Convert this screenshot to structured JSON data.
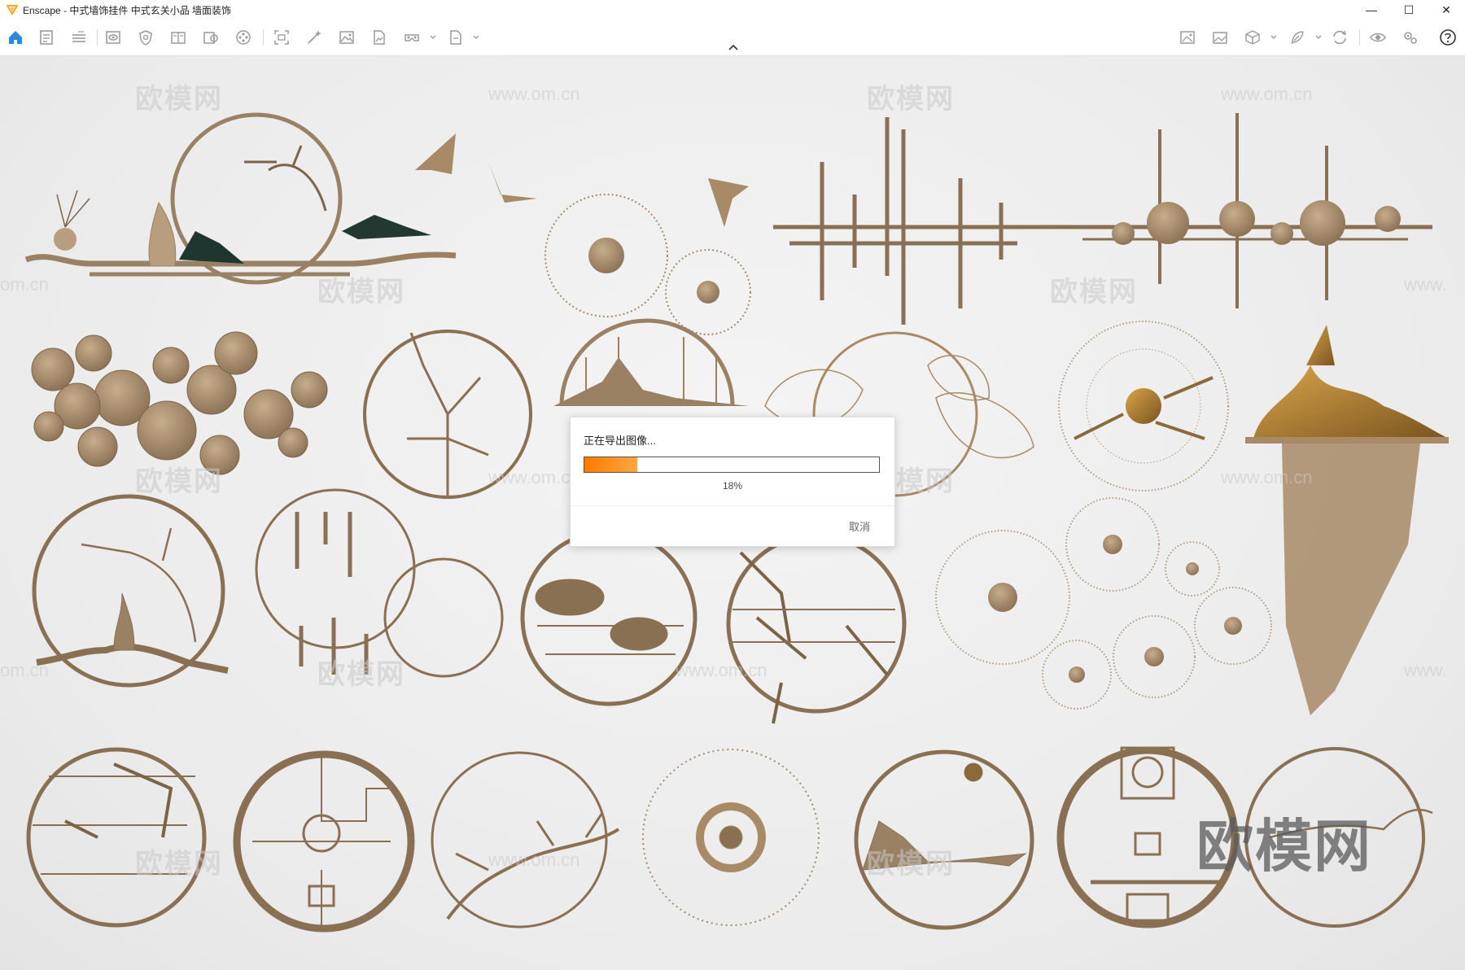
{
  "window": {
    "title": "Enscape - 中式墙饰挂件 中式玄关小品 墙面装饰",
    "controls": {
      "minimize": "—",
      "maximize": "☐",
      "close": "✕"
    }
  },
  "toolbar": {
    "left_icons": [
      "home-icon",
      "document-icon",
      "bim-list-icon",
      "view-eye-icon",
      "shield-icon",
      "book-icon",
      "book-gear-icon",
      "film-reel-icon",
      "capture-icon",
      "magic-wand-icon",
      "image-icon",
      "file-image-icon",
      "vr-headset-icon",
      "export-file-icon"
    ],
    "right_icons": [
      "screenshot-settings-icon",
      "gallery-icon",
      "cube-icon",
      "feather-icon",
      "sync-icon",
      "visibility-icon",
      "settings-gears-icon",
      "help-icon"
    ],
    "accent_color": "#2b8ae0",
    "icon_color": "#9a9a9a"
  },
  "watermarks": {
    "brand": "欧模网",
    "url": "www.om.cn",
    "url_short": "om.cn",
    "url_prefix": "www."
  },
  "export_dialog": {
    "title": "正在导出图像...",
    "progress_fraction": 0.18,
    "progress_label": "18%",
    "cancel_label": "取消",
    "progress_colors": [
      "#ff7a00",
      "#ffa640"
    ]
  },
  "scene": {
    "metal_color": "#9a8163",
    "dark_metal_color": "#6f5a43",
    "gold_color": "#b38a4a"
  }
}
